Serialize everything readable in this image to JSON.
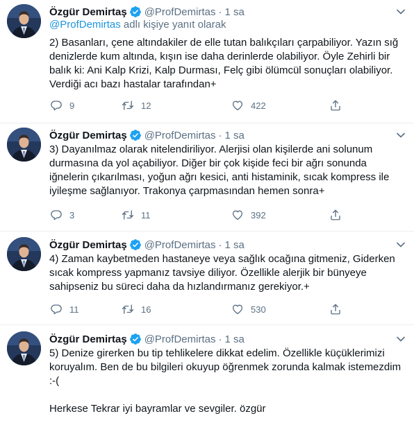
{
  "author": {
    "name": "Özgür Demirtaş",
    "handle": "@ProfDemirtas",
    "separator": "·"
  },
  "colors": {
    "verified": "#1da1f2",
    "link": "#1b95e0",
    "muted": "#5b7083",
    "divider": "#ebeef0"
  },
  "icons": {
    "verified": "verified-badge-icon",
    "more": "chevron-down-icon",
    "reply": "reply-icon",
    "retweet": "retweet-icon",
    "like": "heart-icon",
    "share": "share-icon"
  },
  "tweets": [
    {
      "time": "1 sa",
      "reply_to_mention": "@ProfDemirtas",
      "reply_to_suffix": " adlı kişiye yanıt olarak",
      "text": "2) Basanları, çene altındakiler de elle tutan balıkçıları çarpabiliyor. Yazın sığ denizlerde kum altında, kışın ise daha derinlerde olabiliyor. Öyle Zehirli bir balık ki: Ani Kalp Krizi, Kalp Durması, Felç gibi ölümcül sonuçları olabiliyor. Verdiği acı bazı hastalar tarafından+",
      "replies": "9",
      "retweets": "12",
      "likes": "422"
    },
    {
      "time": "1 sa",
      "text": "3) Dayanılmaz olarak nitelendiriliyor. Alerjisi olan kişilerde ani solunum durmasına da yol açabiliyor. Diğer bir çok kişide feci bir ağrı sonunda iğnelerin çıkarılması, yoğun ağrı kesici, anti histaminik, sıcak kompress ile iyileşme sağlanıyor. Trakonya çarpmasından hemen sonra+",
      "replies": "3",
      "retweets": "11",
      "likes": "392"
    },
    {
      "time": "1 sa",
      "text": "4) Zaman kaybetmeden hastaneye veya sağlık ocağına gitmeniz, Giderken sıcak kompress yapmanız tavsiye diliyor. Özellikle alerjik bir bünyeye sahipseniz bu süreci daha da hızlandırmanız gerekiyor.+",
      "replies": "11",
      "retweets": "16",
      "likes": "530"
    },
    {
      "time": "1 sa",
      "text": "5) Denize girerken bu tip tehlikelere dikkat edelim. Özellikle küçüklerimizi koruyalım. Ben de bu bilgileri okuyup öğrenmek zorunda kalmak istemezdim :-(\n\nHerkese Tekrar iyi bayramlar ve sevgiler. özgür"
    }
  ]
}
